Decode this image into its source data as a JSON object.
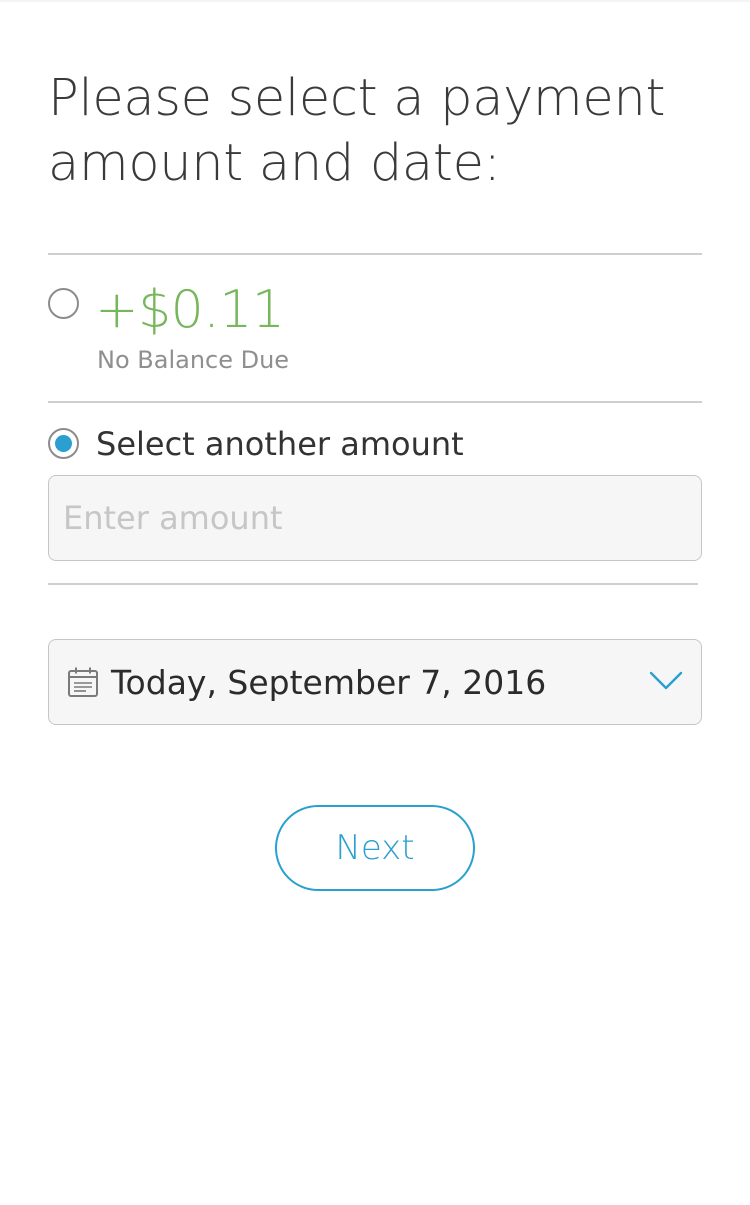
{
  "page": {
    "title": "Please select a payment amount and date:"
  },
  "balance_option": {
    "amount": "+$0.11",
    "note": "No Balance Due",
    "selected": false
  },
  "other_option": {
    "label": "Select another amount",
    "selected": true,
    "input_value": "",
    "input_placeholder": "Enter amount"
  },
  "date_picker": {
    "icon": "calendar-icon",
    "selected_value": "Today, September 7, 2016",
    "dropdown_icon": "chevron-down-icon"
  },
  "actions": {
    "next_label": "Next"
  },
  "colors": {
    "accent": "#2a9fd0",
    "positive_amount": "#77b75c",
    "divider": "#cfcfcf",
    "field_background": "#f6f6f6"
  }
}
